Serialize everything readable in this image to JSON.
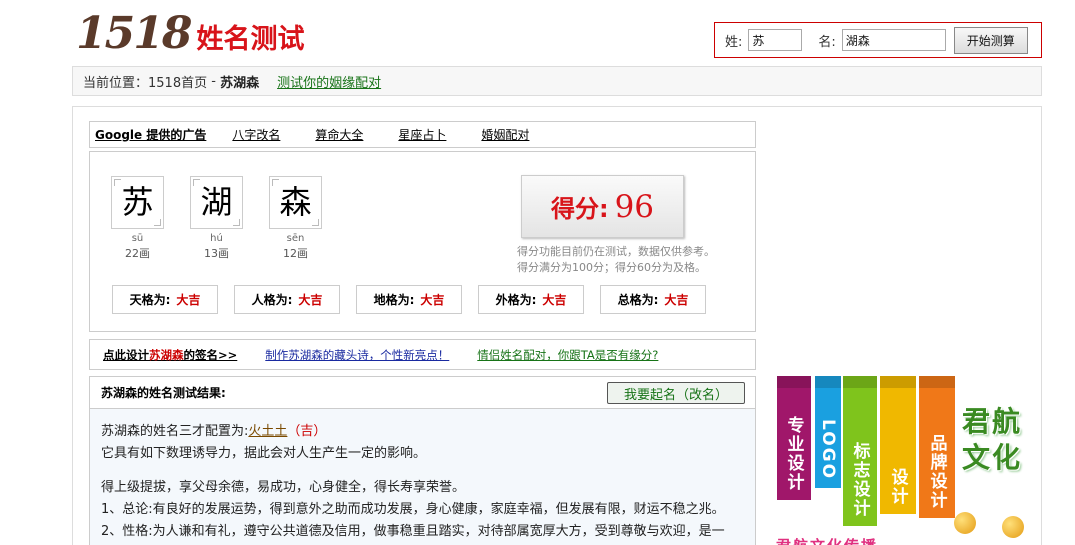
{
  "logo": {
    "num": "1518",
    "text": "姓名测试"
  },
  "search": {
    "surname_label": "姓:",
    "surname_value": "苏",
    "given_label": "名:",
    "given_value": "湖森",
    "button": "开始测算"
  },
  "breadcrumb": {
    "prefix": "当前位置：",
    "home": "1518首页",
    "sep": " - ",
    "current": "苏湖森",
    "link": "测试你的姻缘配对"
  },
  "links_bar": {
    "ad_label": "Google 提供的广告",
    "items": [
      "八字改名",
      "算命大全",
      "星座占卜",
      "婚姻配对"
    ]
  },
  "name_chars": [
    {
      "char": "苏",
      "pinyin": "sū",
      "strokes": "22画"
    },
    {
      "char": "湖",
      "pinyin": "hú",
      "strokes": "13画"
    },
    {
      "char": "森",
      "pinyin": "sēn",
      "strokes": "12画"
    }
  ],
  "score": {
    "label": "得分:",
    "value": "96",
    "note1": "得分功能目前仍在测试，数据仅供参考。",
    "note2": "得分满分为100分；得分60分为及格。"
  },
  "ge": [
    {
      "label": "天格为:",
      "value": "大吉"
    },
    {
      "label": "人格为:",
      "value": "大吉"
    },
    {
      "label": "地格为:",
      "value": "大吉"
    },
    {
      "label": "外格为:",
      "value": "大吉"
    },
    {
      "label": "总格为:",
      "value": "大吉"
    }
  ],
  "promo": {
    "p1_prefix": "点此设计",
    "p1_name": "苏湖森",
    "p1_suffix": "的签名>>",
    "p2": "制作苏湖森的藏头诗，个性新亮点！",
    "p3": "情侣姓名配对，你跟TA是否有缘分?"
  },
  "result": {
    "title": "苏湖森的姓名测试结果:",
    "button": "我要起名（改名）",
    "line1_prefix": "苏湖森的姓名三才配置为:",
    "line1_sancai": "火土土",
    "line1_ji": "（吉）",
    "line2": "它具有如下数理诱导力，据此会对人生产生一定的影响。",
    "line3": "得上级提拔，享父母余德，易成功，心身健全，得长寿享荣誉。",
    "line4": "1、总论:有良好的发展运势，得到意外之助而成功发展，身心健康，家庭幸福，但发展有限，财运不稳之兆。",
    "line5": "2、性格:为人谦和有礼，遵守公共道德及信用，做事稳重且踏实，对待部属宽厚大方，受到尊敬与欢迎，是一"
  },
  "ad": {
    "bars": [
      "专业设计",
      "LOGO",
      "标志设计",
      "设计",
      "品牌设计"
    ],
    "bar_colors": [
      "#a0176a",
      "#1aa0e0",
      "#7fc41c",
      "#f0b800",
      "#f07818"
    ],
    "brand": "君航文化",
    "bottom": "君航文化传播"
  }
}
